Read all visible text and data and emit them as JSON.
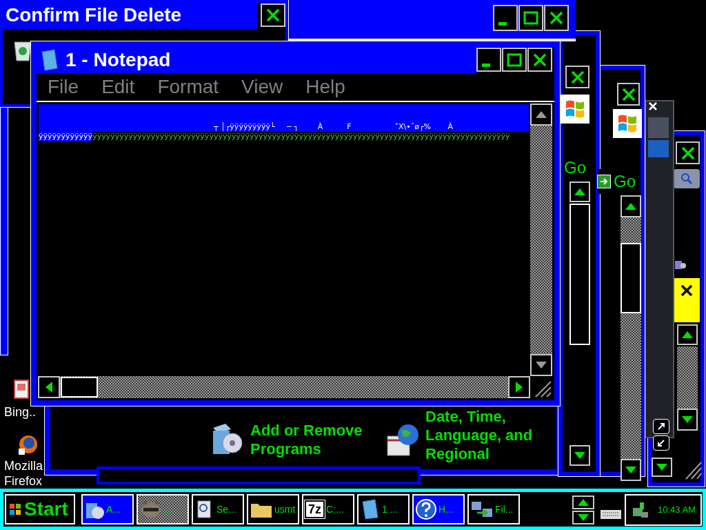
{
  "confirm_dialog": {
    "title": "Confirm File Delete"
  },
  "notepad": {
    "title": "1 - Notepad",
    "menu": [
      {
        "label": "File"
      },
      {
        "label": "Edit"
      },
      {
        "label": "Format"
      },
      {
        "label": "View"
      },
      {
        "label": "Help"
      }
    ],
    "lines": [
      [
        {
          "text": "┬ │┌ÿÿÿÿÿÿÿÿÿ└     ─ ┐        À          F                  ˚X\\•ˆø┌%       À",
          "selected": true
        }
      ],
      [
        {
          "text": "ÿÿÿÿÿÿÿÿÿÿÿÿ",
          "selected": true
        },
        {
          "text": "ÿÿÿÿÿÿÿÿÿÿÿÿÿÿÿÿÿÿÿÿÿÿÿÿÿÿÿÿÿÿÿÿÿÿÿÿÿÿÿÿÿÿÿÿÿÿÿÿÿÿÿÿÿÿÿÿÿÿÿÿÿÿÿÿÿÿÿÿÿÿÿÿÿÿÿÿÿÿÿÿÿÿÿÿÿÿÿÿÿÿÿÿÿ",
          "selected": false
        }
      ]
    ]
  },
  "control_panel": {
    "items": [
      {
        "label": "Add or Remove Programs"
      },
      {
        "label": "Date, Time, Language, and Regional"
      }
    ]
  },
  "go_buttons": [
    "Go",
    "Go"
  ],
  "desktop_icons": [
    {
      "label": "Bing.."
    },
    {
      "label": "Mozilla Firefox"
    }
  ],
  "taskbar": {
    "start": "Start",
    "tasks": [
      {
        "label": "A...",
        "selected": false,
        "highlighted": true
      },
      {
        "label": "...",
        "selected": true,
        "highlighted": false
      },
      {
        "label": "Se...",
        "selected": false,
        "highlighted": false
      },
      {
        "label": "usmt",
        "selected": false,
        "highlighted": false
      },
      {
        "label": "C:...",
        "selected": false,
        "highlighted": false,
        "icon_text": "7z"
      },
      {
        "label": "1 ...",
        "selected": false,
        "highlighted": false
      },
      {
        "label": "H...",
        "selected": false,
        "highlighted": true
      },
      {
        "label": "Fil...",
        "selected": false,
        "highlighted": false
      }
    ],
    "clock": "10:43 AM"
  }
}
